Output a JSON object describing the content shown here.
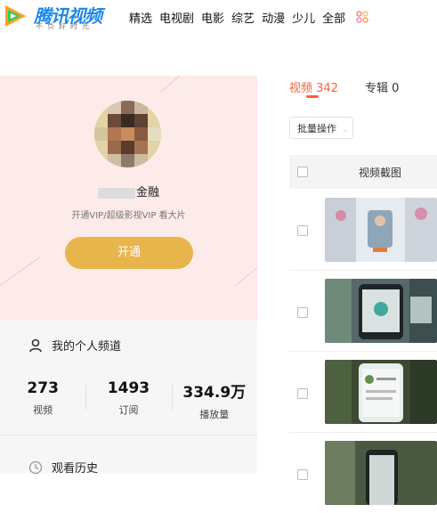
{
  "header": {
    "logo_text": "腾讯视频",
    "logo_slogan": "不负好时光",
    "nav": [
      "精选",
      "电视剧",
      "电影",
      "综艺",
      "动漫",
      "少儿",
      "全部"
    ]
  },
  "profile": {
    "username_suffix": "金融",
    "vip_tip": "开通VIP/超级影视VIP 看大片",
    "open_button": "开通"
  },
  "channel": {
    "label": "我的个人频道",
    "stats": [
      {
        "value": "273",
        "label": "视频"
      },
      {
        "value": "1493",
        "label": "订阅"
      },
      {
        "value": "334.9万",
        "label": "播放量"
      }
    ],
    "history_label": "观看历史"
  },
  "content": {
    "tabs": [
      {
        "label": "视频",
        "count": "342"
      },
      {
        "label": "专辑",
        "count": "0"
      }
    ],
    "batch_button": "批量操作",
    "table_header": "视频截图"
  },
  "colors": {
    "accent": "#ff5c38",
    "vip_button": "#e8b54c",
    "profile_bg": "#fcebe8",
    "brand_blue": "#1e88e5"
  }
}
